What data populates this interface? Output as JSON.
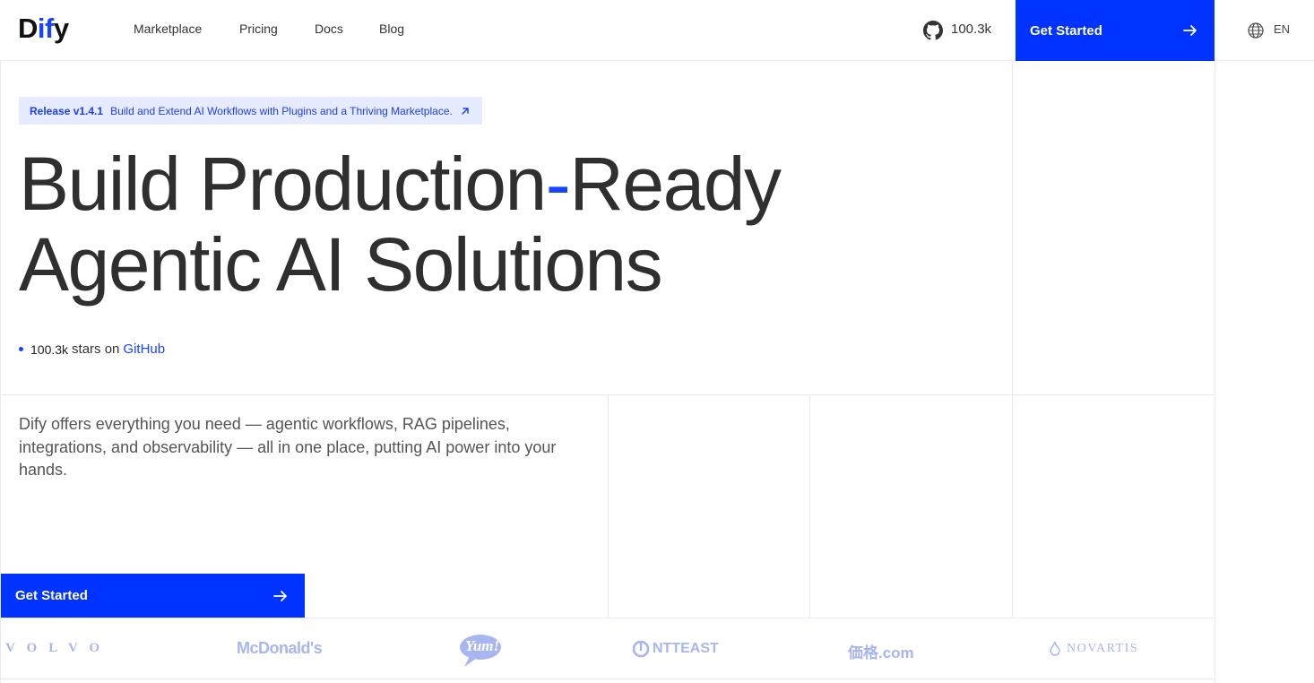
{
  "header": {
    "logo": {
      "prefix": "D",
      "highlight": "if",
      "suffix": "y"
    },
    "nav": [
      {
        "label": "Marketplace"
      },
      {
        "label": "Pricing"
      },
      {
        "label": "Docs"
      },
      {
        "label": "Blog"
      }
    ],
    "github_stars": "100.3k",
    "cta_label": "Get Started",
    "language": "EN"
  },
  "release": {
    "version": "Release v1.4.1",
    "text": "Build and Extend AI Workflows with Plugins and a Thriving Marketplace."
  },
  "hero": {
    "line1_a": "Build Production",
    "line1_dash": "-",
    "line1_b": "Ready",
    "line2": "Agentic AI Solutions"
  },
  "github_line": {
    "count": "100.3k",
    "text": "stars on",
    "link": "GitHub"
  },
  "description": "Dify offers everything you need — agentic workflows, RAG pipelines, integrations, and observability — all in one place, putting AI power into your hands.",
  "main_cta": {
    "label": "Get Started"
  },
  "customer_logos": [
    {
      "name": "VOLVO"
    },
    {
      "name": "McDonald's"
    },
    {
      "name": "Yum!"
    },
    {
      "name": "NTTEAST"
    },
    {
      "name": "価格.com"
    },
    {
      "name": "NOVARTIS"
    }
  ],
  "colors": {
    "accent": "#0033ff",
    "logo_tint": "#a8b6f0",
    "grid": "#e6e8f3"
  }
}
